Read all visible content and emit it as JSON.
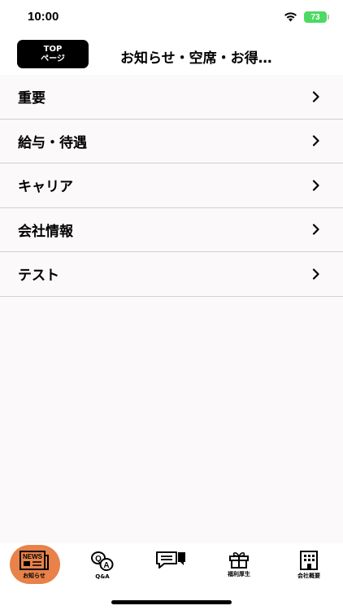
{
  "status_bar": {
    "time": "10:00",
    "battery": "73"
  },
  "nav": {
    "top_button_line1": "TOP",
    "top_button_line2": "ページ",
    "title": "お知らせ・空席・お得…"
  },
  "list": {
    "items": [
      {
        "label": "重要"
      },
      {
        "label": "給与・待遇"
      },
      {
        "label": "キャリア"
      },
      {
        "label": "会社情報"
      },
      {
        "label": "テスト"
      }
    ]
  },
  "tab_bar": {
    "tabs": [
      {
        "label": "お知らせ",
        "icon": "news-icon",
        "active": true
      },
      {
        "label": "Q&A",
        "icon": "qa-icon",
        "active": false
      },
      {
        "label": "",
        "icon": "chat-icon",
        "active": false
      },
      {
        "label": "福利厚生",
        "icon": "gift-icon",
        "active": false
      },
      {
        "label": "会社概要",
        "icon": "building-icon",
        "active": false
      }
    ],
    "news_icon_text": "NEWS",
    "active_color": "#e8824a"
  }
}
